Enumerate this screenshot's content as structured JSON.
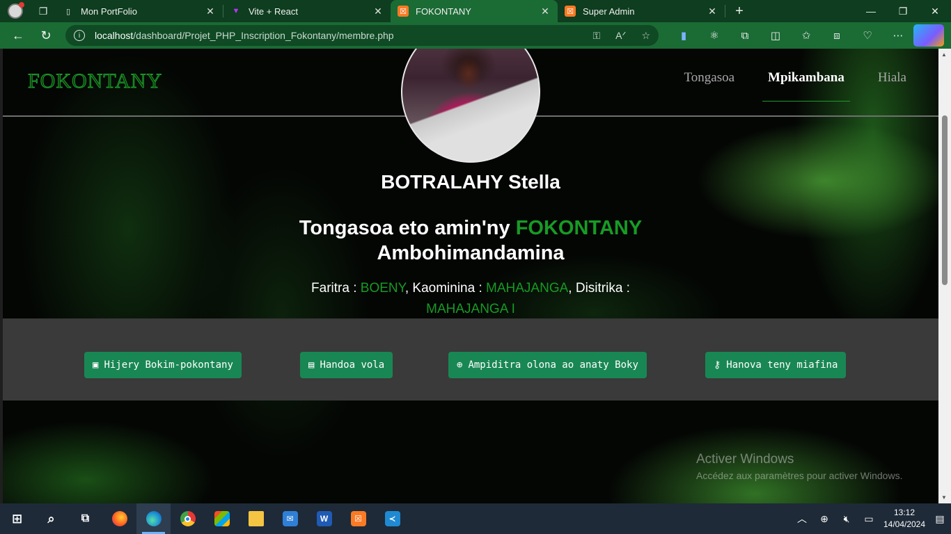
{
  "browser": {
    "tabs": [
      {
        "title": "Mon PortFolio",
        "icon": "page-icon",
        "active": false
      },
      {
        "title": "Vite + React",
        "icon": "vite-icon",
        "active": false
      },
      {
        "title": "FOKONTANY",
        "icon": "xampp-icon",
        "active": true
      },
      {
        "title": "Super Admin",
        "icon": "xampp-icon",
        "active": false
      }
    ],
    "url_host": "localhost",
    "url_path": "/dashboard/Projet_PHP_Inscription_Fokontany/membre.php"
  },
  "site": {
    "brand": "FOKONTANY",
    "nav": [
      {
        "label": "Tongasoa",
        "active": false
      },
      {
        "label": "Mpikambana",
        "active": true
      },
      {
        "label": "Hiala",
        "active": false
      }
    ],
    "member_name": "BOTRALAHY Stella",
    "welcome_prefix": "Tongasoa eto amin'ny",
    "welcome_brand": "FOKONTANY",
    "welcome_place": "Ambohimandamina",
    "location": {
      "region_label": "Faritra :",
      "region": "BOENY",
      "commune_label": "Kaominina :",
      "commune": "MAHAJANGA",
      "district_label": "Disitrika :",
      "district": "MAHAJANGA I"
    },
    "actions": [
      {
        "label": "Hijery Bokim-pokontany",
        "icon": "id-card-icon"
      },
      {
        "label": "Handoa vola",
        "icon": "money-icon"
      },
      {
        "label": "Ampiditra olona ao anaty Boky",
        "icon": "plus-circle-icon"
      },
      {
        "label": "Hanova teny miafina",
        "icon": "key-icon"
      }
    ]
  },
  "watermark": {
    "title": "Activer Windows",
    "subtitle": "Accédez aux paramètres pour activer Windows."
  },
  "taskbar": {
    "time": "13:12",
    "date": "14/04/2024"
  },
  "colors": {
    "accent_green": "#179b24",
    "button_green": "#198754",
    "browser_green": "#1b6b35"
  }
}
